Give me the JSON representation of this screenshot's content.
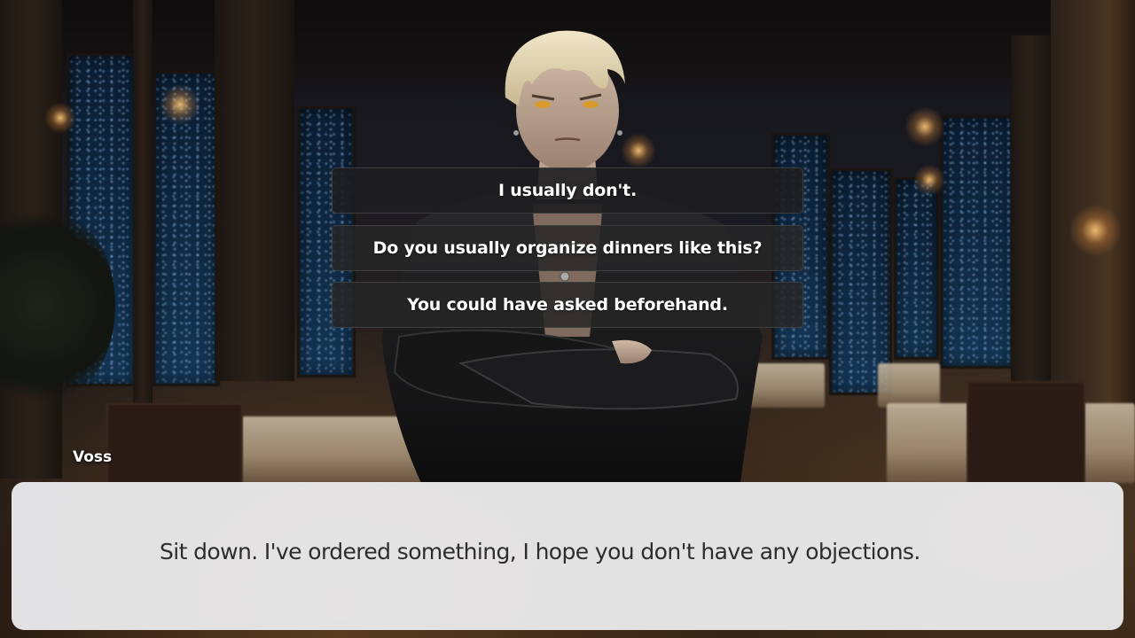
{
  "scene": {
    "background_name": "upscale-restaurant-night",
    "character_name": "Voss"
  },
  "choices": [
    {
      "label": "I usually don't."
    },
    {
      "label": "Do you usually organize dinners like this?"
    },
    {
      "label": "You could have asked beforehand."
    }
  ],
  "dialogue": {
    "speaker": "Voss",
    "text": "Sit down. I've ordered something, I hope you don't have any objections."
  },
  "colors": {
    "choice_bg": "#262628",
    "choice_text": "#ffffff",
    "dialogue_bg": "#ececee",
    "dialogue_text": "#2d2d2d",
    "speaker_text": "#ffffff"
  }
}
